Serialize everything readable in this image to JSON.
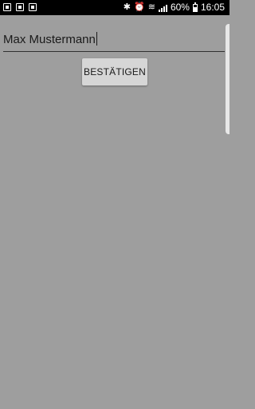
{
  "status_bar": {
    "battery_percent": "60%",
    "time": "16:05",
    "icons": [
      "gallery-icon",
      "image-icon",
      "sim-icon",
      "bluetooth-icon",
      "alarm-icon",
      "wifi-icon",
      "signal-icon",
      "battery-icon"
    ]
  },
  "form": {
    "name_value": "Max Mustermann",
    "confirm_label": "BESTÄTIGEN"
  }
}
